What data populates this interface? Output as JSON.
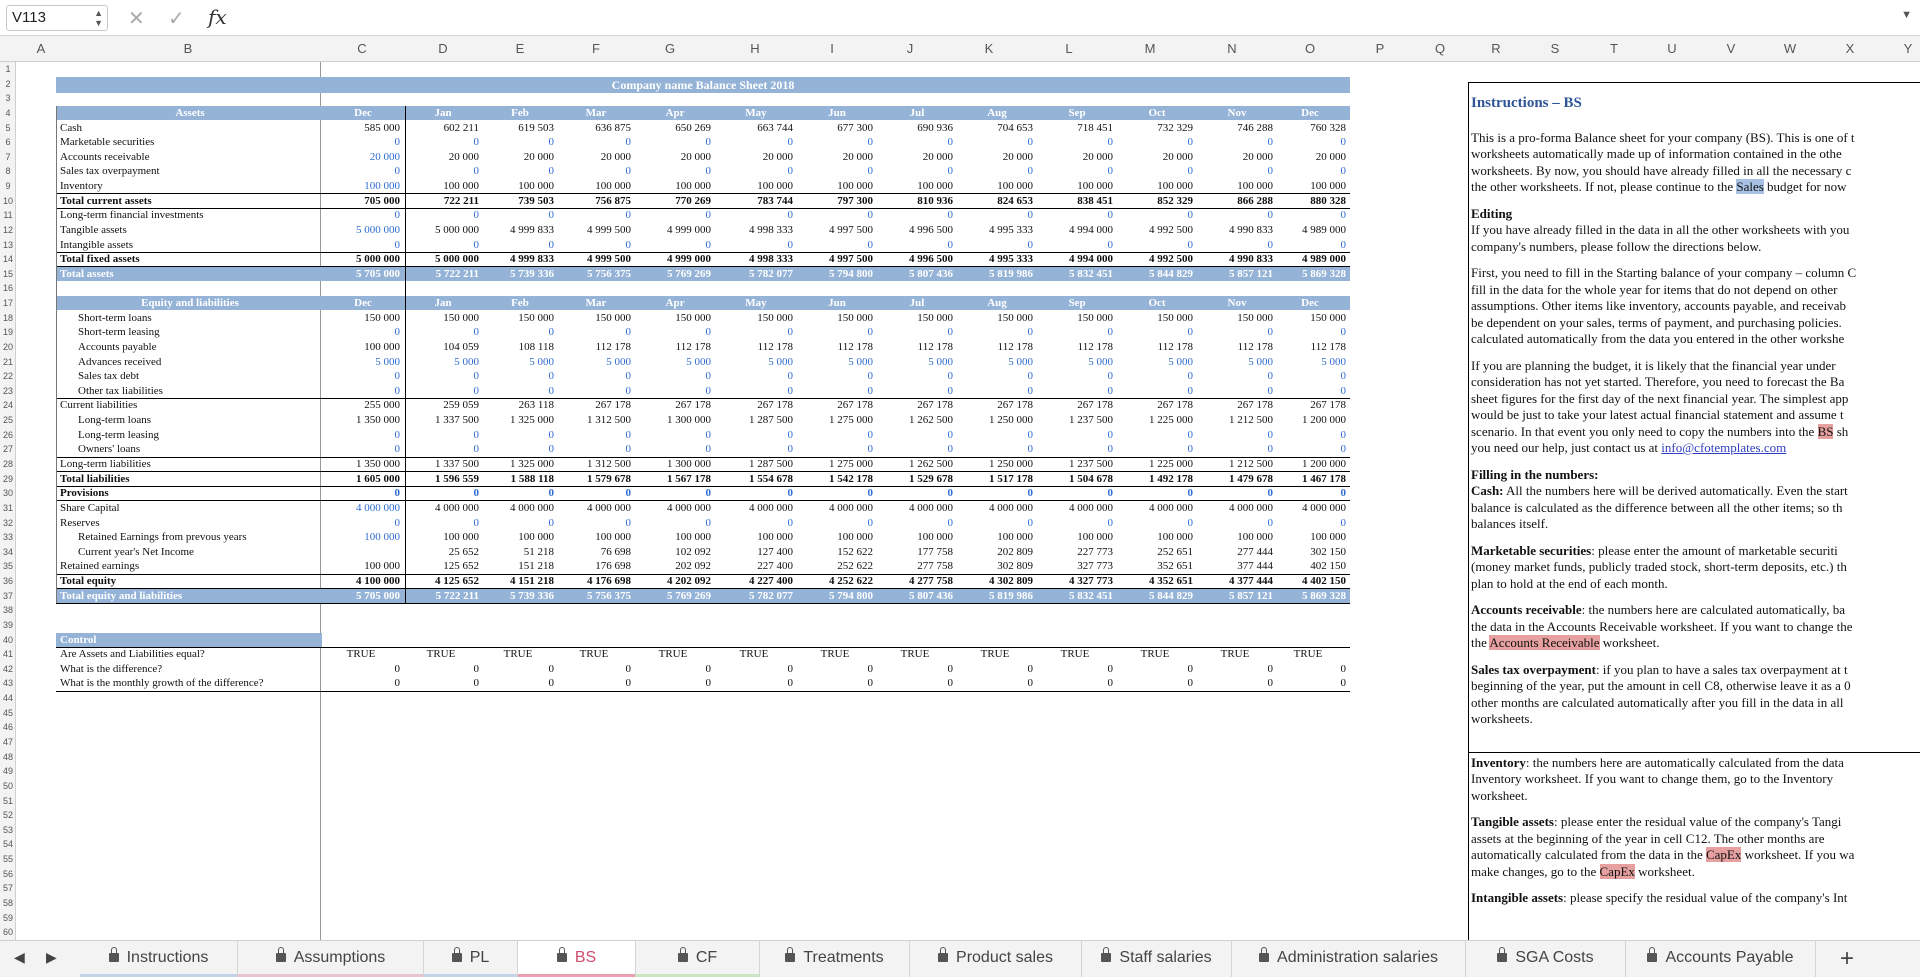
{
  "formula_bar": {
    "cell_ref": "V113",
    "fx": "fx",
    "value": ""
  },
  "columns": [
    "A",
    "B",
    "C",
    "D",
    "E",
    "F",
    "G",
    "H",
    "I",
    "J",
    "K",
    "L",
    "M",
    "N",
    "O",
    "P",
    "Q",
    "R",
    "S",
    "T",
    "U",
    "V",
    "W",
    "X",
    "Y"
  ],
  "rows": [
    "1",
    "2",
    "3",
    "4",
    "5",
    "6",
    "7",
    "8",
    "9",
    "10",
    "11",
    "12",
    "13",
    "14",
    "15",
    "16",
    "17",
    "18",
    "19",
    "20",
    "21",
    "22",
    "23",
    "24",
    "25",
    "26",
    "27",
    "28",
    "29",
    "30",
    "31",
    "32",
    "33",
    "34",
    "35",
    "36",
    "37",
    "38",
    "39",
    "40",
    "41",
    "42",
    "43",
    "44",
    "45",
    "46",
    "47",
    "48",
    "49",
    "50",
    "51",
    "52",
    "53",
    "54",
    "55",
    "56",
    "57",
    "58",
    "59",
    "60"
  ],
  "sheet": {
    "title": "Company name Balance Sheet 2018",
    "months": [
      "Dec",
      "Jan",
      "Feb",
      "Mar",
      "Apr",
      "May",
      "Jun",
      "Jul",
      "Aug",
      "Sep",
      "Oct",
      "Nov",
      "Dec"
    ],
    "assets_header": "Assets",
    "assets": [
      {
        "label": "Cash",
        "values": [
          "585 000",
          "602 211",
          "619 503",
          "636 875",
          "650 269",
          "663 744",
          "677 300",
          "690 936",
          "704 653",
          "718 451",
          "732 329",
          "746 288",
          "760 328"
        ]
      },
      {
        "label": "Marketable securities",
        "values": [
          "0",
          "0",
          "0",
          "0",
          "0",
          "0",
          "0",
          "0",
          "0",
          "0",
          "0",
          "0",
          "0"
        ]
      },
      {
        "label": "Accounts receivable",
        "values": [
          "20 000",
          "20 000",
          "20 000",
          "20 000",
          "20 000",
          "20 000",
          "20 000",
          "20 000",
          "20 000",
          "20 000",
          "20 000",
          "20 000",
          "20 000"
        ]
      },
      {
        "label": "Sales tax overpayment",
        "values": [
          "0",
          "0",
          "0",
          "0",
          "0",
          "0",
          "0",
          "0",
          "0",
          "0",
          "0",
          "0",
          "0"
        ]
      },
      {
        "label": "Inventory",
        "values": [
          "100 000",
          "100 000",
          "100 000",
          "100 000",
          "100 000",
          "100 000",
          "100 000",
          "100 000",
          "100 000",
          "100 000",
          "100 000",
          "100 000",
          "100 000"
        ]
      },
      {
        "label": "Total current assets",
        "values": [
          "705 000",
          "722 211",
          "739 503",
          "756 875",
          "770 269",
          "783 744",
          "797 300",
          "810 936",
          "824 653",
          "838 451",
          "852 329",
          "866 288",
          "880 328"
        ]
      },
      {
        "label": "Long-term financial investments",
        "values": [
          "0",
          "0",
          "0",
          "0",
          "0",
          "0",
          "0",
          "0",
          "0",
          "0",
          "0",
          "0",
          "0"
        ]
      },
      {
        "label": "Tangible assets",
        "values": [
          "5 000 000",
          "5 000 000",
          "4 999 833",
          "4 999 500",
          "4 999 000",
          "4 998 333",
          "4 997 500",
          "4 996 500",
          "4 995 333",
          "4 994 000",
          "4 992 500",
          "4 990 833",
          "4 989 000"
        ]
      },
      {
        "label": "Intangible assets",
        "values": [
          "0",
          "0",
          "0",
          "0",
          "0",
          "0",
          "0",
          "0",
          "0",
          "0",
          "0",
          "0",
          "0"
        ]
      },
      {
        "label": "Total fixed assets",
        "values": [
          "5 000 000",
          "5 000 000",
          "4 999 833",
          "4 999 500",
          "4 999 000",
          "4 998 333",
          "4 997 500",
          "4 996 500",
          "4 995 333",
          "4 994 000",
          "4 992 500",
          "4 990 833",
          "4 989 000"
        ]
      },
      {
        "label": "Total assets",
        "values": [
          "5 705 000",
          "5 722 211",
          "5 739 336",
          "5 756 375",
          "5 769 269",
          "5 782 077",
          "5 794 800",
          "5 807 436",
          "5 819 986",
          "5 832 451",
          "5 844 829",
          "5 857 121",
          "5 869 328"
        ]
      }
    ],
    "liab_header": "Equity and liabilities",
    "liabilities": [
      {
        "label": "Short-term loans",
        "values": [
          "150 000",
          "150 000",
          "150 000",
          "150 000",
          "150 000",
          "150 000",
          "150 000",
          "150 000",
          "150 000",
          "150 000",
          "150 000",
          "150 000",
          "150 000"
        ]
      },
      {
        "label": "Short-term leasing",
        "values": [
          "0",
          "0",
          "0",
          "0",
          "0",
          "0",
          "0",
          "0",
          "0",
          "0",
          "0",
          "0",
          "0"
        ]
      },
      {
        "label": "Accounts payable",
        "values": [
          "100 000",
          "104 059",
          "108 118",
          "112 178",
          "112 178",
          "112 178",
          "112 178",
          "112 178",
          "112 178",
          "112 178",
          "112 178",
          "112 178",
          "112 178"
        ]
      },
      {
        "label": "Advances received",
        "values": [
          "5 000",
          "5 000",
          "5 000",
          "5 000",
          "5 000",
          "5 000",
          "5 000",
          "5 000",
          "5 000",
          "5 000",
          "5 000",
          "5 000",
          "5 000"
        ]
      },
      {
        "label": "Sales tax debt",
        "values": [
          "0",
          "0",
          "0",
          "0",
          "0",
          "0",
          "0",
          "0",
          "0",
          "0",
          "0",
          "0",
          "0"
        ]
      },
      {
        "label": "Other tax liabilities",
        "values": [
          "0",
          "0",
          "0",
          "0",
          "0",
          "0",
          "0",
          "0",
          "0",
          "0",
          "0",
          "0",
          "0"
        ]
      },
      {
        "label": "Current liabilities",
        "values": [
          "255 000",
          "259 059",
          "263 118",
          "267 178",
          "267 178",
          "267 178",
          "267 178",
          "267 178",
          "267 178",
          "267 178",
          "267 178",
          "267 178",
          "267 178"
        ]
      },
      {
        "label": "Long-term loans",
        "values": [
          "1 350 000",
          "1 337 500",
          "1 325 000",
          "1 312 500",
          "1 300 000",
          "1 287 500",
          "1 275 000",
          "1 262 500",
          "1 250 000",
          "1 237 500",
          "1 225 000",
          "1 212 500",
          "1 200 000"
        ]
      },
      {
        "label": "Long-term leasing",
        "values": [
          "0",
          "0",
          "0",
          "0",
          "0",
          "0",
          "0",
          "0",
          "0",
          "0",
          "0",
          "0",
          "0"
        ]
      },
      {
        "label": "Owners' loans",
        "values": [
          "0",
          "0",
          "0",
          "0",
          "0",
          "0",
          "0",
          "0",
          "0",
          "0",
          "0",
          "0",
          "0"
        ]
      },
      {
        "label": "Long-term liabilities",
        "values": [
          "1 350 000",
          "1 337 500",
          "1 325 000",
          "1 312 500",
          "1 300 000",
          "1 287 500",
          "1 275 000",
          "1 262 500",
          "1 250 000",
          "1 237 500",
          "1 225 000",
          "1 212 500",
          "1 200 000"
        ]
      },
      {
        "label": "Total liabilities",
        "values": [
          "1 605 000",
          "1 596 559",
          "1 588 118",
          "1 579 678",
          "1 567 178",
          "1 554 678",
          "1 542 178",
          "1 529 678",
          "1 517 178",
          "1 504 678",
          "1 492 178",
          "1 479 678",
          "1 467 178"
        ]
      },
      {
        "label": "Provisions",
        "values": [
          "0",
          "0",
          "0",
          "0",
          "0",
          "0",
          "0",
          "0",
          "0",
          "0",
          "0",
          "0",
          "0"
        ]
      },
      {
        "label": "Share Capital",
        "values": [
          "4 000 000",
          "4 000 000",
          "4 000 000",
          "4 000 000",
          "4 000 000",
          "4 000 000",
          "4 000 000",
          "4 000 000",
          "4 000 000",
          "4 000 000",
          "4 000 000",
          "4 000 000",
          "4 000 000"
        ]
      },
      {
        "label": "Reserves",
        "values": [
          "0",
          "0",
          "0",
          "0",
          "0",
          "0",
          "0",
          "0",
          "0",
          "0",
          "0",
          "0",
          "0"
        ]
      },
      {
        "label": "Retained Earnings from prevous years",
        "values": [
          "100 000",
          "100 000",
          "100 000",
          "100 000",
          "100 000",
          "100 000",
          "100 000",
          "100 000",
          "100 000",
          "100 000",
          "100 000",
          "100 000",
          "100 000"
        ]
      },
      {
        "label": "Current year's Net Income",
        "values": [
          "",
          "25 652",
          "51 218",
          "76 698",
          "102 092",
          "127 400",
          "152 622",
          "177 758",
          "202 809",
          "227 773",
          "252 651",
          "277 444",
          "302 150"
        ]
      },
      {
        "label": "Retained earnings",
        "values": [
          "100 000",
          "125 652",
          "151 218",
          "176 698",
          "202 092",
          "227 400",
          "252 622",
          "277 758",
          "302 809",
          "327 773",
          "352 651",
          "377 444",
          "402 150"
        ]
      },
      {
        "label": "Total equity",
        "values": [
          "4 100 000",
          "4 125 652",
          "4 151 218",
          "4 176 698",
          "4 202 092",
          "4 227 400",
          "4 252 622",
          "4 277 758",
          "4 302 809",
          "4 327 773",
          "4 352 651",
          "4 377 444",
          "4 402 150"
        ]
      },
      {
        "label": "Total equity and liabilities",
        "values": [
          "5 705 000",
          "5 722 211",
          "5 739 336",
          "5 756 375",
          "5 769 269",
          "5 782 077",
          "5 794 800",
          "5 807 436",
          "5 819 986",
          "5 832 451",
          "5 844 829",
          "5 857 121",
          "5 869 328"
        ]
      }
    ],
    "control_header": "Control",
    "control": [
      {
        "label": "Are Assets and Liabilities equal?",
        "values": [
          "TRUE",
          "TRUE",
          "TRUE",
          "TRUE",
          "TRUE",
          "TRUE",
          "TRUE",
          "TRUE",
          "TRUE",
          "TRUE",
          "TRUE",
          "TRUE",
          "TRUE"
        ]
      },
      {
        "label": "What is the difference?",
        "values": [
          "0",
          "0",
          "0",
          "0",
          "0",
          "0",
          "0",
          "0",
          "0",
          "0",
          "0",
          "0",
          "0"
        ]
      },
      {
        "label": "What is the monthly growth of the difference?",
        "values": [
          "0",
          "0",
          "0",
          "0",
          "0",
          "0",
          "0",
          "0",
          "0",
          "0",
          "0",
          "0",
          "0"
        ]
      }
    ]
  },
  "instructions": {
    "title": "Instructions – BS",
    "p1": [
      "This is a pro-forma Balance sheet for your company (BS). This is one of t",
      "worksheets automatically made up of information contained in the othe",
      "worksheets. By now, you should have already filled in all the necessary c",
      "the other worksheets. If not, please continue to the ",
      "Sales",
      " budget for now"
    ],
    "editing_title": "Editing",
    "editing": [
      "If you have already filled in the data in all the other worksheets with you",
      "company's numbers, please follow the directions below."
    ],
    "p2": [
      "First, you need to fill in the Starting balance of your company – column C",
      "fill in the data for the whole year for items that do not depend on other",
      "assumptions. Other items like inventory, accounts payable, and receivab",
      "be dependent on your sales, terms of payment, and purchasing policies.",
      "calculated automatically from the data you entered in the other workshe"
    ],
    "p3": [
      "If you are planning the budget, it is likely that the financial year under",
      "consideration has not yet started. Therefore, you need to forecast the Ba",
      "sheet figures for the first day of the next financial year. The simplest app",
      "would be just to take your latest actual financial statement and assume t",
      "scenario. In that event you only need to copy the numbers into the ",
      "BS",
      " sh",
      "you need our help, just contact us at ",
      "info@cfotemplates.com"
    ],
    "filling_title": "Filling in the numbers:",
    "cash": [
      "Cash:",
      " All the numbers here will be derived automatically. Even the start",
      "balance is calculated as the difference between all the other items; so th",
      "balances itself."
    ],
    "ms": [
      "Marketable securities",
      ": please enter the amount of marketable securiti",
      "(money market funds, publicly traded stock, short-term deposits, etc.) th",
      "plan to hold at the end of each month."
    ],
    "ar": [
      "Accounts receivable",
      ": the numbers here are calculated automatically, ba",
      "the data in the Accounts Receivable worksheet. If you want to change the",
      "the ",
      "Accounts Receivable",
      " worksheet."
    ],
    "sto": [
      "Sales tax overpayment",
      ": if you plan to have a sales tax overpayment at t",
      "beginning of the year, put the amount in cell C8, otherwise leave it as a 0",
      "other months are calculated automatically after you fill in the data in all",
      "worksheets."
    ],
    "inv": [
      "Inventory",
      ": the numbers here are automatically calculated from the data",
      "Inventory worksheet. If you want to change them, go to the Inventory",
      "worksheet."
    ],
    "ta": [
      "Tangible assets",
      ": please enter the residual value of the company's Tangi",
      "assets at the beginning of the year in cell C12. The other months are",
      "automatically calculated from the data in the ",
      "CapEx",
      " worksheet. If you wa",
      "make changes, go to the ",
      "CapEx",
      " worksheet."
    ],
    "ia": [
      "Intangible assets",
      ": please specify the residual value of the company's Int"
    ]
  },
  "tabs": [
    {
      "label": "Instructions",
      "color": "#c5d3e8"
    },
    {
      "label": "Assumptions",
      "color": "#e8c5cd"
    },
    {
      "label": "PL",
      "color": "#c5d3e8"
    },
    {
      "label": "BS",
      "color": "#e8a0b0",
      "active": true
    },
    {
      "label": "CF",
      "color": "#c8e6c0"
    },
    {
      "label": "Treatments",
      "color": ""
    },
    {
      "label": "Product sales",
      "color": ""
    },
    {
      "label": "Staff salaries",
      "color": ""
    },
    {
      "label": "Administration salaries",
      "color": ""
    },
    {
      "label": "SGA Costs",
      "color": ""
    },
    {
      "label": "Accounts Payable",
      "color": ""
    }
  ],
  "tab_add": "+"
}
